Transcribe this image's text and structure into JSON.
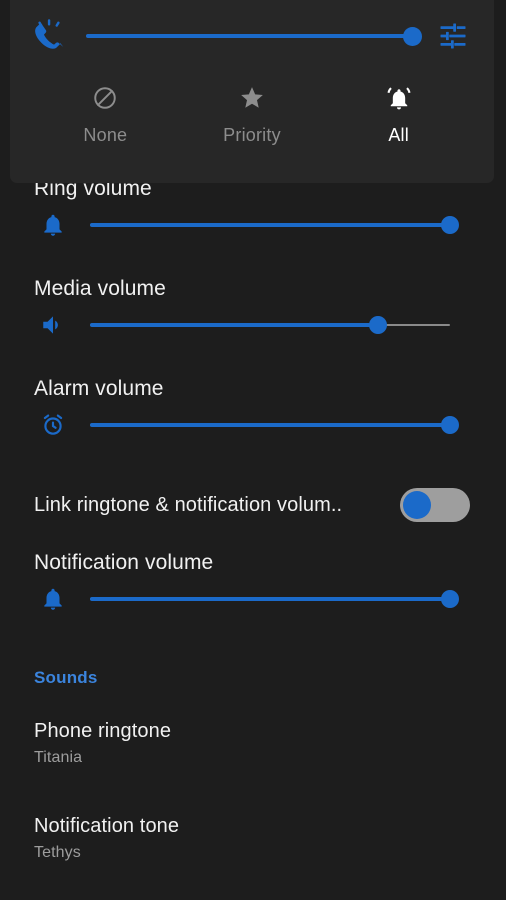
{
  "theme": {
    "background": "#1d1d1d",
    "panel_background": "#272727",
    "accent": "#1b6ac9",
    "section_header_color": "#3b84dd",
    "primary_text": "#f1f1f1",
    "secondary_text": "#9d9d9d",
    "inactive_text": "#8d8d8d",
    "switch_track": "#9e9e9e"
  },
  "volume_panel": {
    "ringer_icon": "ring-volume-icon",
    "ringer_slider": {
      "value": 100,
      "min": 0,
      "max": 100
    },
    "expand_icon": "tune-settings-icon",
    "dnd_modes": [
      {
        "id": "none",
        "label": "None",
        "icon": "block-circle-icon",
        "selected": false
      },
      {
        "id": "priority",
        "label": "Priority",
        "icon": "star-icon",
        "selected": false
      },
      {
        "id": "all",
        "label": "All",
        "icon": "ringing-bell-icon",
        "selected": true
      }
    ]
  },
  "volumes": [
    {
      "id": "ring",
      "title": "Ring volume",
      "icon": "bell-icon",
      "slider": {
        "value": 100,
        "min": 0,
        "max": 100
      }
    },
    {
      "id": "media",
      "title": "Media volume",
      "icon": "speaker-volume-icon",
      "slider": {
        "value": 80,
        "min": 0,
        "max": 100
      }
    },
    {
      "id": "alarm",
      "title": "Alarm volume",
      "icon": "alarm-clock-icon",
      "slider": {
        "value": 100,
        "min": 0,
        "max": 100
      }
    }
  ],
  "link_toggle": {
    "label": "Link ringtone & notification volum..",
    "checked": false
  },
  "notification_volume": {
    "id": "notification",
    "title": "Notification volume",
    "icon": "bell-icon",
    "slider": {
      "value": 100,
      "min": 0,
      "max": 100
    }
  },
  "sounds_section": {
    "header": "Sounds",
    "items": [
      {
        "title": "Phone ringtone",
        "value": "Titania"
      },
      {
        "title": "Notification tone",
        "value": "Tethys"
      }
    ]
  }
}
